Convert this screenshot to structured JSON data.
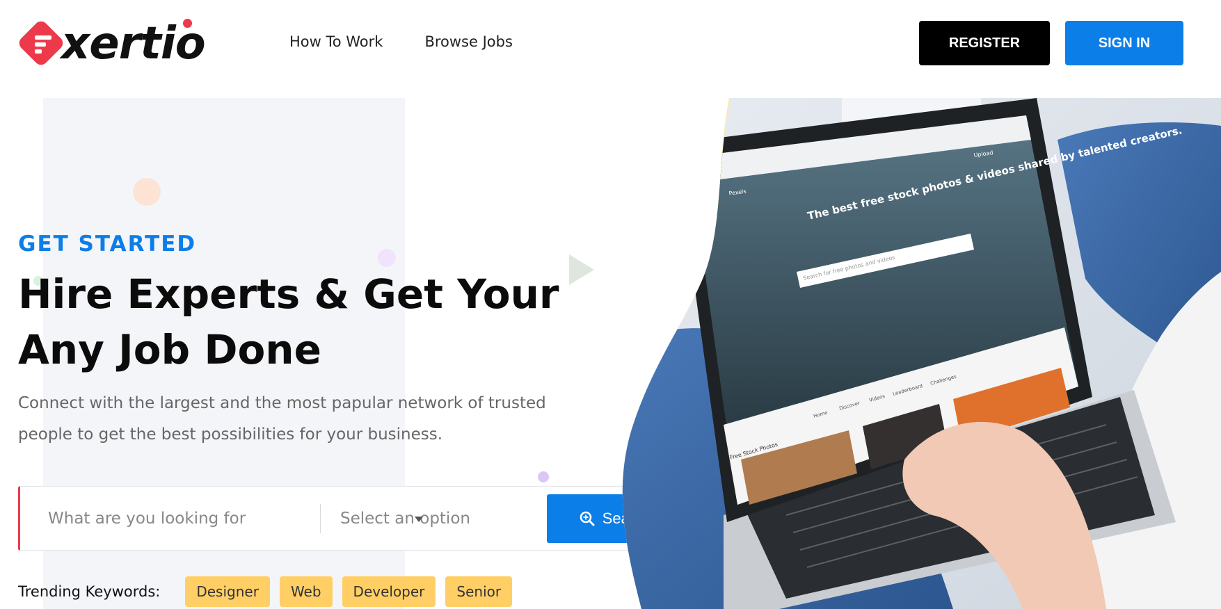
{
  "header": {
    "logo_text": "xertio",
    "nav": [
      {
        "label": "How To Work"
      },
      {
        "label": "Browse Jobs"
      }
    ],
    "register_label": "REGISTER",
    "signin_label": "SIGN IN"
  },
  "hero": {
    "eyebrow": "GET STARTED",
    "headline": "Hire Experts & Get Your Any Job Done",
    "subtext": "Connect with the largest and the most papular network of trusted people to get the best possibilities for your business.",
    "search": {
      "placeholder": "What are you looking for",
      "select_value": "Select an option",
      "button_label": "Search"
    },
    "trending_label": "Trending Keywords:",
    "trending_tags": [
      "Designer",
      "Web",
      "Developer",
      "Senior"
    ],
    "screen_text": {
      "headline": "The best free stock photos & videos shared by talented creators.",
      "search_placeholder": "Search for free photos and videos",
      "tabs": [
        "Home",
        "Discover",
        "Videos",
        "Leaderboard",
        "Challenges"
      ],
      "section_title": "Free Stock Photos",
      "upload_label": "Upload",
      "brand": "Pexels"
    }
  },
  "colors": {
    "accent_blue": "#0b7ee8",
    "brand_red": "#ec3a4b",
    "tag_yellow": "#ffcf66"
  }
}
